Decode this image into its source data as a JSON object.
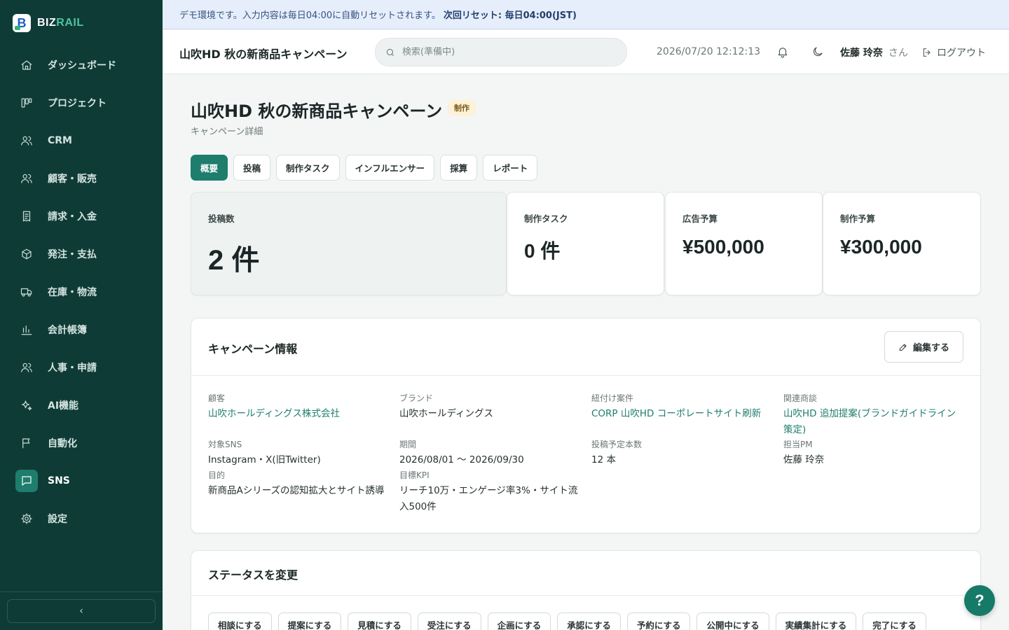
{
  "brand": {
    "letter": "B",
    "name_part1": "BIZ",
    "name_part2": "RAIL"
  },
  "sidebar": {
    "items": [
      {
        "label": "ダッシュボード",
        "icon": "home-icon"
      },
      {
        "label": "プロジェクト",
        "icon": "kanban-icon"
      },
      {
        "label": "CRM",
        "icon": "users-icon"
      },
      {
        "label": "顧客・販売",
        "icon": "users-icon"
      },
      {
        "label": "請求・入金",
        "icon": "receipt-icon"
      },
      {
        "label": "発注・支払",
        "icon": "box-icon"
      },
      {
        "label": "在庫・物流",
        "icon": "truck-icon"
      },
      {
        "label": "会計帳簿",
        "icon": "bar-chart-icon"
      },
      {
        "label": "人事・申請",
        "icon": "users-icon"
      },
      {
        "label": "AI機能",
        "icon": "sparkle-icon"
      },
      {
        "label": "自動化",
        "icon": "flag-icon"
      },
      {
        "label": "SNS",
        "icon": "message-icon",
        "active": true
      },
      {
        "label": "設定",
        "icon": "gear-icon"
      }
    ],
    "collapse_glyph": "‹"
  },
  "banner": {
    "text": "デモ環境です。入力内容は毎日04:00に自動リセットされます。",
    "emphasis": "次回リセット: 毎日04:00(JST)"
  },
  "header": {
    "title": "山吹HD 秋の新商品キャンペーン",
    "search_placeholder": "検索(準備中)",
    "datetime": "2026/07/20 12:12:13",
    "user_name": "佐藤 玲奈",
    "user_suffix": "さん",
    "logout_label": "ログアウト"
  },
  "page": {
    "title": "山吹HD 秋の新商品キャンペーン",
    "badge": "制作",
    "subtitle": "キャンペーン詳細",
    "tabs": [
      "概要",
      "投稿",
      "制作タスク",
      "インフルエンサー",
      "採算",
      "レポート"
    ],
    "active_tab": 0
  },
  "stats": [
    {
      "label": "投稿数",
      "value": "2 件"
    },
    {
      "label": "制作タスク",
      "value": "0 件"
    },
    {
      "label": "広告予算",
      "value": "¥500,000"
    },
    {
      "label": "制作予算",
      "value": "¥300,000"
    }
  ],
  "campaign_info": {
    "title": "キャンペーン情報",
    "edit_label": "編集する",
    "fields": [
      {
        "label": "顧客",
        "value": "山吹ホールディングス株式会社",
        "link": true
      },
      {
        "label": "ブランド",
        "value": "山吹ホールディングス",
        "link": false
      },
      {
        "label": "紐付け案件",
        "value": "CORP 山吹HD コーポレートサイト刷新",
        "link": true
      },
      {
        "label": "関連商談",
        "value": "山吹HD 追加提案(ブランドガイドライン策定)",
        "link": true
      },
      {
        "label": "対象SNS",
        "value": "Instagram・X(旧Twitter)",
        "link": false
      },
      {
        "label": "期間",
        "value": "2026/08/01 〜 2026/09/30",
        "link": false
      },
      {
        "label": "投稿予定本数",
        "value": "12 本",
        "link": false
      },
      {
        "label": "担当PM",
        "value": "佐藤 玲奈",
        "link": false
      },
      {
        "label": "目的",
        "value": "新商品Aシリーズの認知拡大とサイト誘導",
        "link": false
      },
      {
        "label": "目標KPI",
        "value": "リーチ10万・エンゲージ率3%・サイト流入500件",
        "link": false
      }
    ]
  },
  "status_change": {
    "title": "ステータスを変更",
    "buttons": [
      "相談にする",
      "提案にする",
      "見積にする",
      "受注にする",
      "企画にする",
      "承認にする",
      "予約にする",
      "公開中にする",
      "実績集計にする",
      "完了にする"
    ]
  },
  "help_label": "?",
  "colors": {
    "sidebar_bg": "#0f3b36",
    "accent": "#1e7d6c",
    "banner_bg": "#e6eefb",
    "badge_bg": "#fdf2d8"
  }
}
